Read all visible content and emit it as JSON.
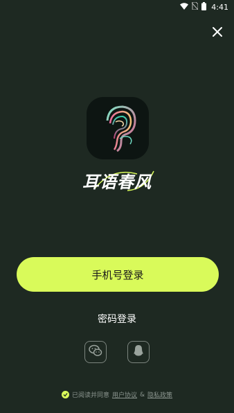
{
  "status_bar": {
    "time": "4:41",
    "icons": [
      "wifi-icon",
      "no-sim-icon",
      "battery-icon"
    ]
  },
  "header": {
    "close_icon": "close-icon"
  },
  "app": {
    "name": "耳语春风",
    "icon": "app-logo-icon"
  },
  "login": {
    "phone_login_label": "手机号登录",
    "password_login_label": "密码登录",
    "social": [
      {
        "icon": "wechat-icon"
      },
      {
        "icon": "qq-icon"
      }
    ]
  },
  "agreement": {
    "prefix": "已阅读并同意",
    "user_agreement": "用户协议",
    "conjunction": "&",
    "privacy_policy": "隐私政策",
    "checked": true
  },
  "colors": {
    "background": "#1e2922",
    "accent": "#d9fa5a",
    "muted_text": "#8a948e"
  }
}
